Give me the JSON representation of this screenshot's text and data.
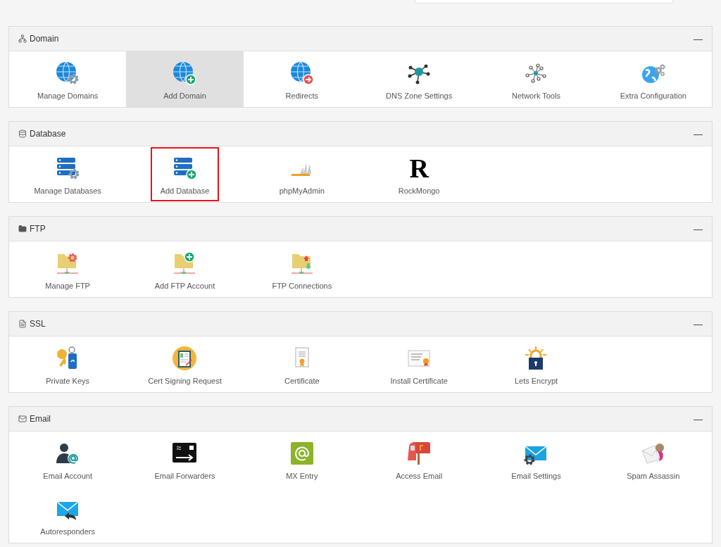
{
  "sections": [
    {
      "title": "Domain",
      "collapse": "—",
      "items": [
        {
          "label": "Manage Domains",
          "selected": false,
          "highlighted": false
        },
        {
          "label": "Add Domain",
          "selected": true,
          "highlighted": false
        },
        {
          "label": "Redirects",
          "selected": false,
          "highlighted": false
        },
        {
          "label": "DNS Zone Settings",
          "selected": false,
          "highlighted": false
        },
        {
          "label": "Network Tools",
          "selected": false,
          "highlighted": false
        },
        {
          "label": "Extra Configuration",
          "selected": false,
          "highlighted": false
        }
      ]
    },
    {
      "title": "Database",
      "collapse": "—",
      "items": [
        {
          "label": "Manage Databases",
          "selected": false,
          "highlighted": false
        },
        {
          "label": "Add Database",
          "selected": false,
          "highlighted": true
        },
        {
          "label": "phpMyAdmin",
          "selected": false,
          "highlighted": false
        },
        {
          "label": "RockMongo",
          "glyph": "R",
          "selected": false,
          "highlighted": false
        }
      ]
    },
    {
      "title": "FTP",
      "collapse": "—",
      "items": [
        {
          "label": "Manage FTP",
          "selected": false,
          "highlighted": false
        },
        {
          "label": "Add FTP Account",
          "selected": false,
          "highlighted": false
        },
        {
          "label": "FTP Connections",
          "selected": false,
          "highlighted": false
        }
      ]
    },
    {
      "title": "SSL",
      "collapse": "—",
      "items": [
        {
          "label": "Private Keys",
          "selected": false,
          "highlighted": false
        },
        {
          "label": "Cert Signing Request",
          "selected": false,
          "highlighted": false
        },
        {
          "label": "Certificate",
          "selected": false,
          "highlighted": false
        },
        {
          "label": "Install Certificate",
          "selected": false,
          "highlighted": false
        },
        {
          "label": "Lets Encrypt",
          "selected": false,
          "highlighted": false
        }
      ]
    },
    {
      "title": "Email",
      "collapse": "—",
      "items": [
        {
          "label": "Email Account",
          "selected": false,
          "highlighted": false
        },
        {
          "label": "Email Forwarders",
          "selected": false,
          "highlighted": false
        },
        {
          "label": "MX Entry",
          "selected": false,
          "highlighted": false
        },
        {
          "label": "Access Email",
          "selected": false,
          "highlighted": false
        },
        {
          "label": "Email Settings",
          "selected": false,
          "highlighted": false
        },
        {
          "label": "Spam Assassin",
          "selected": false,
          "highlighted": false
        },
        {
          "label": "Autoresponders",
          "selected": false,
          "highlighted": false
        }
      ]
    }
  ]
}
